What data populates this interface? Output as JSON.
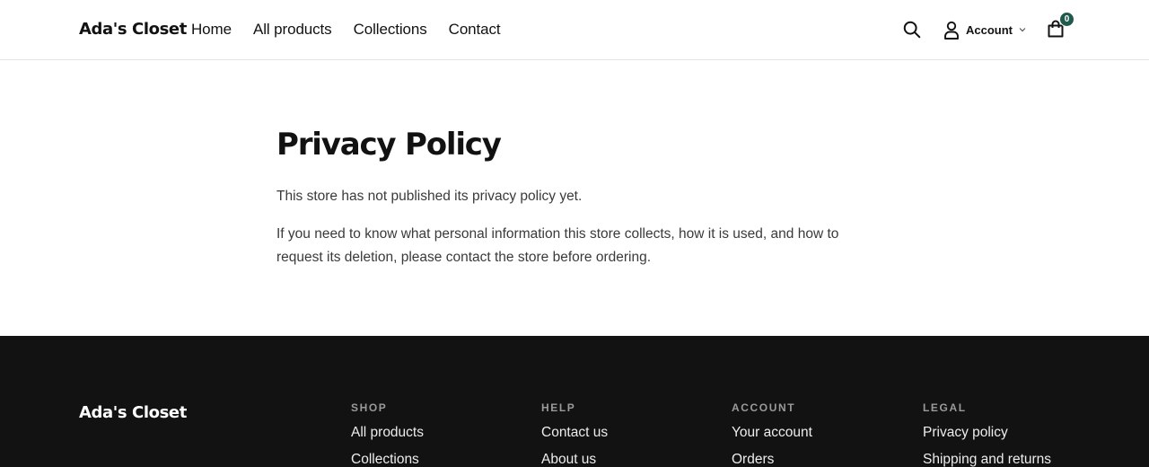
{
  "header": {
    "brand": "Ada's Closet",
    "nav": [
      "Home",
      "All products",
      "Collections",
      "Contact"
    ],
    "account_label": "Account",
    "cart_count": "0",
    "icons": {
      "search": "search-icon",
      "account": "user-icon",
      "cart": "shopping-bag-icon",
      "chevron": "chevron-down-icon"
    },
    "badge_color": "#1f5a4c"
  },
  "main": {
    "title": "Privacy Policy",
    "paragraphs": [
      "This store has not published its privacy policy yet.",
      "If you need to know what personal information this store collects, how it is used, and how to request its deletion, please contact the store before ordering."
    ]
  },
  "footer": {
    "brand": "Ada's Closet",
    "background": "#121212",
    "columns": [
      {
        "heading": "SHOP",
        "links": [
          "All products",
          "Collections"
        ]
      },
      {
        "heading": "HELP",
        "links": [
          "Contact us",
          "About us"
        ]
      },
      {
        "heading": "ACCOUNT",
        "links": [
          "Your account",
          "Orders"
        ]
      },
      {
        "heading": "LEGAL",
        "links": [
          "Privacy policy",
          "Shipping and returns"
        ]
      }
    ]
  }
}
